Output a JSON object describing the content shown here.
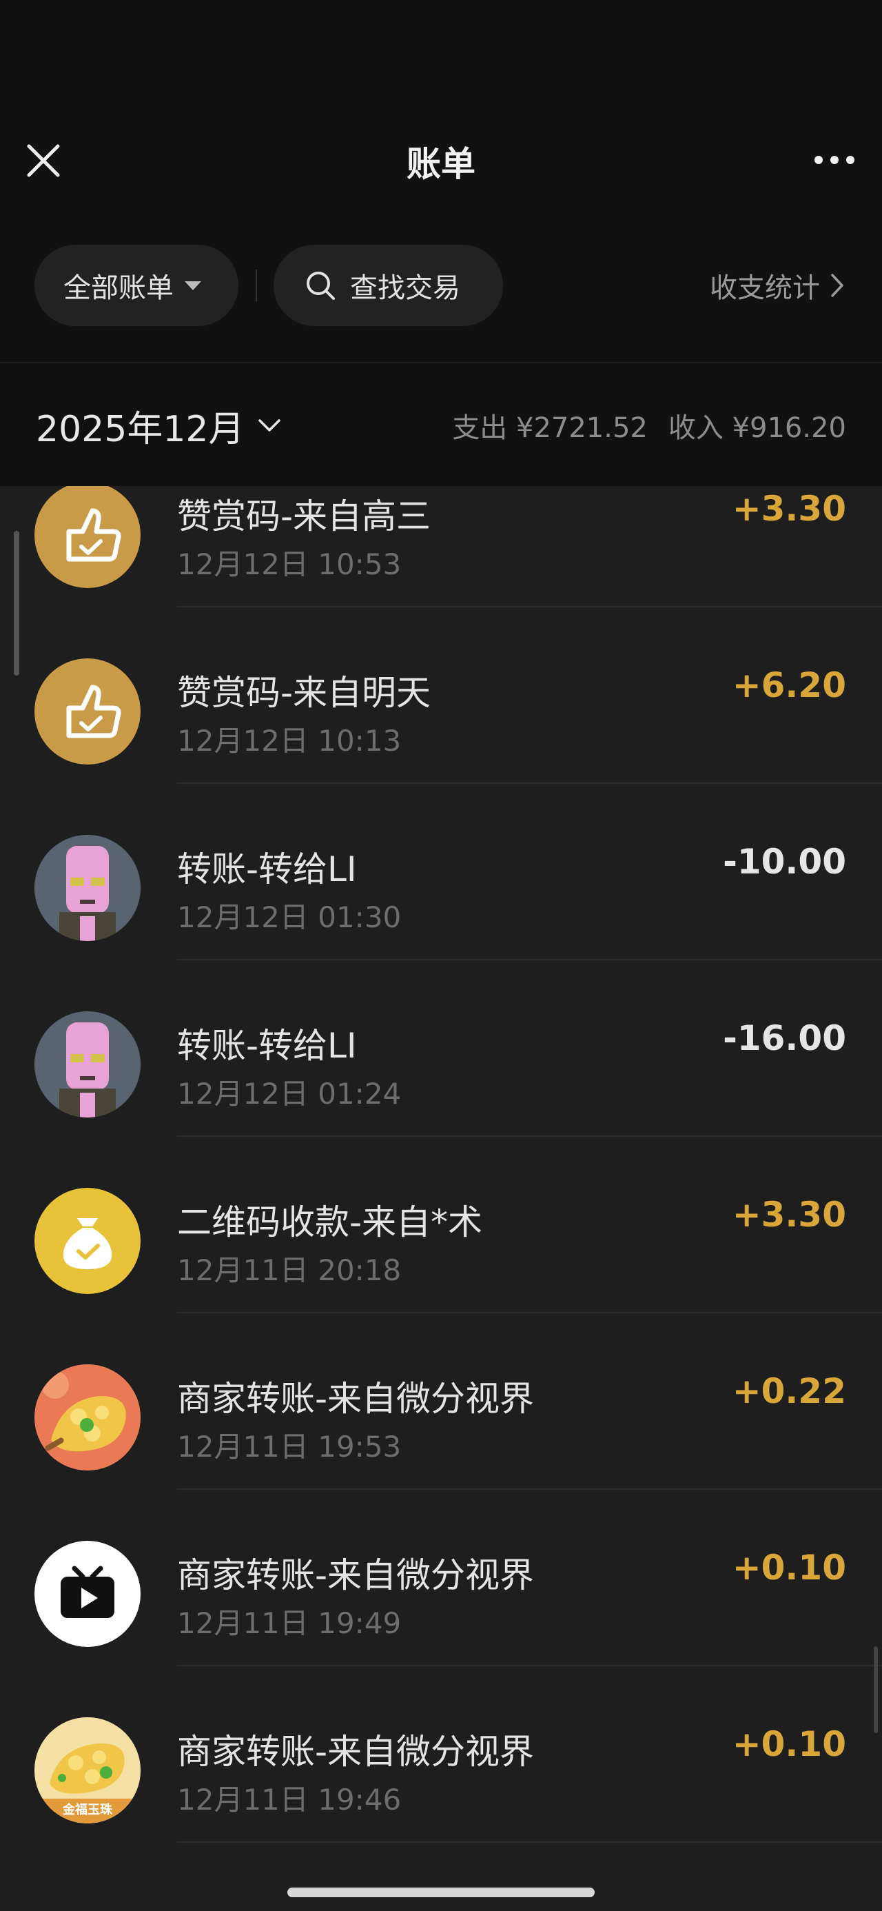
{
  "header": {
    "title": "账单",
    "close_icon": "close-icon",
    "more_icon": "more-dots-icon"
  },
  "filters": {
    "all_bills_label": "全部账单",
    "search_label": "查找交易",
    "stats_label": "收支统计"
  },
  "month_bar": {
    "month": "2025年12月",
    "expense": "支出 ¥2721.52",
    "income": "收入 ¥916.20"
  },
  "colors": {
    "income_amount": "#d9a63a",
    "expense_amount": "#e6e6e6",
    "background": "#1e1e1e",
    "header_background": "#111111"
  },
  "transactions": [
    {
      "title": "赞赏码-来自高三",
      "time": "12月12日 10:53",
      "amount": "+3.30",
      "type": "income",
      "icon": "thumbs-up-icon"
    },
    {
      "title": "赞赏码-来自明天",
      "time": "12月12日 10:13",
      "amount": "+6.20",
      "type": "income",
      "icon": "thumbs-up-icon"
    },
    {
      "title": "转账-转给LI",
      "time": "12月12日 01:30",
      "amount": "-10.00",
      "type": "expense",
      "icon": "user-avatar"
    },
    {
      "title": "转账-转给LI",
      "time": "12月12日 01:24",
      "amount": "-16.00",
      "type": "expense",
      "icon": "user-avatar"
    },
    {
      "title": "二维码收款-来自*术",
      "time": "12月11日 20:18",
      "amount": "+3.30",
      "type": "income",
      "icon": "money-bag-icon"
    },
    {
      "title": "商家转账-来自微分视界",
      "time": "12月11日 19:53",
      "amount": "+0.22",
      "type": "income",
      "icon": "merchant-avatar"
    },
    {
      "title": "商家转账-来自微分视界",
      "time": "12月11日 19:49",
      "amount": "+0.10",
      "type": "income",
      "icon": "tv-icon"
    },
    {
      "title": "商家转账-来自微分视界",
      "time": "12月11日 19:46",
      "amount": "+0.10",
      "type": "income",
      "icon": "merchant-avatar",
      "avatar_text": "金福玉珠"
    }
  ]
}
